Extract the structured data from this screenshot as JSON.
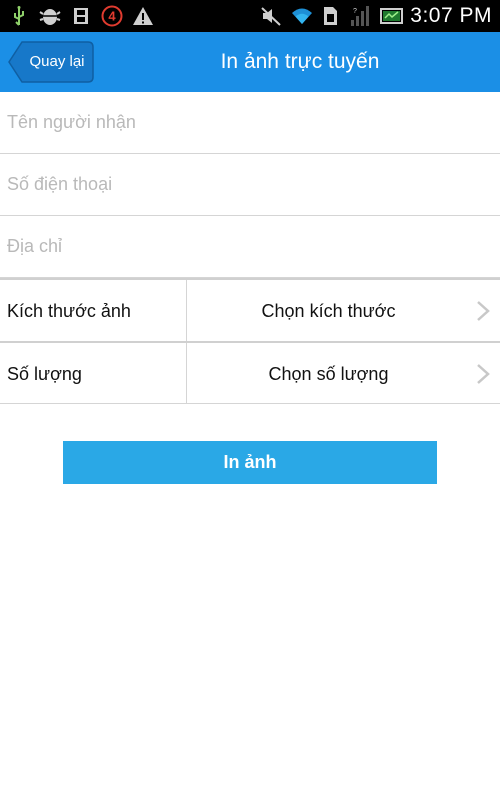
{
  "status_bar": {
    "time": "3:07 PM",
    "notification_count": "4",
    "icons": [
      "usb-icon",
      "android-debug-icon",
      "sd-card-icon",
      "notification-count-icon",
      "warning-icon",
      "mute-icon",
      "wifi-icon",
      "sim-card-icon",
      "signal-icon",
      "battery-icon"
    ]
  },
  "nav": {
    "back_label": "Quay lại",
    "title": "In ảnh trực tuyến"
  },
  "form": {
    "recipient_placeholder": "Tên người nhận",
    "phone_placeholder": "Số điện thoại",
    "address_placeholder": "Địa chỉ",
    "size_label": "Kích thước ảnh",
    "size_value": "Chọn kích thước",
    "quantity_label": "Số lượng",
    "quantity_value": "Chọn số lượng"
  },
  "actions": {
    "print_label": "In ảnh"
  },
  "colors": {
    "nav_background": "#1b8fe6",
    "button_background": "#2aa8e6",
    "status_bar_background": "#000000"
  }
}
